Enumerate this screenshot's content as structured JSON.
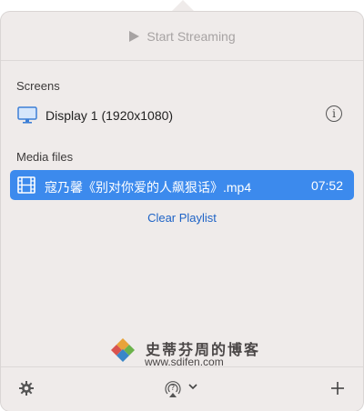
{
  "toolbar": {
    "stream_label": "Start Streaming"
  },
  "screens": {
    "title": "Screens",
    "items": [
      {
        "label": "Display 1 (1920x1080)"
      }
    ]
  },
  "media": {
    "title": "Media files",
    "items": [
      {
        "name": "寇乃馨《别对你爱的人飙狠话》.mp4",
        "duration": "07:52",
        "selected": true
      }
    ],
    "clear_label": "Clear Playlist"
  },
  "watermark": {
    "text_cn": "史蒂芬周的博客",
    "url": "www.sdifen.com"
  },
  "colors": {
    "accent": "#3c8aed",
    "link": "#1e63c6",
    "panel": "#efebea"
  },
  "icons": [
    "play-icon",
    "display-icon",
    "info-icon",
    "film-icon",
    "gear-icon",
    "airplay-help-icon",
    "chevron-down-icon",
    "plus-icon"
  ]
}
